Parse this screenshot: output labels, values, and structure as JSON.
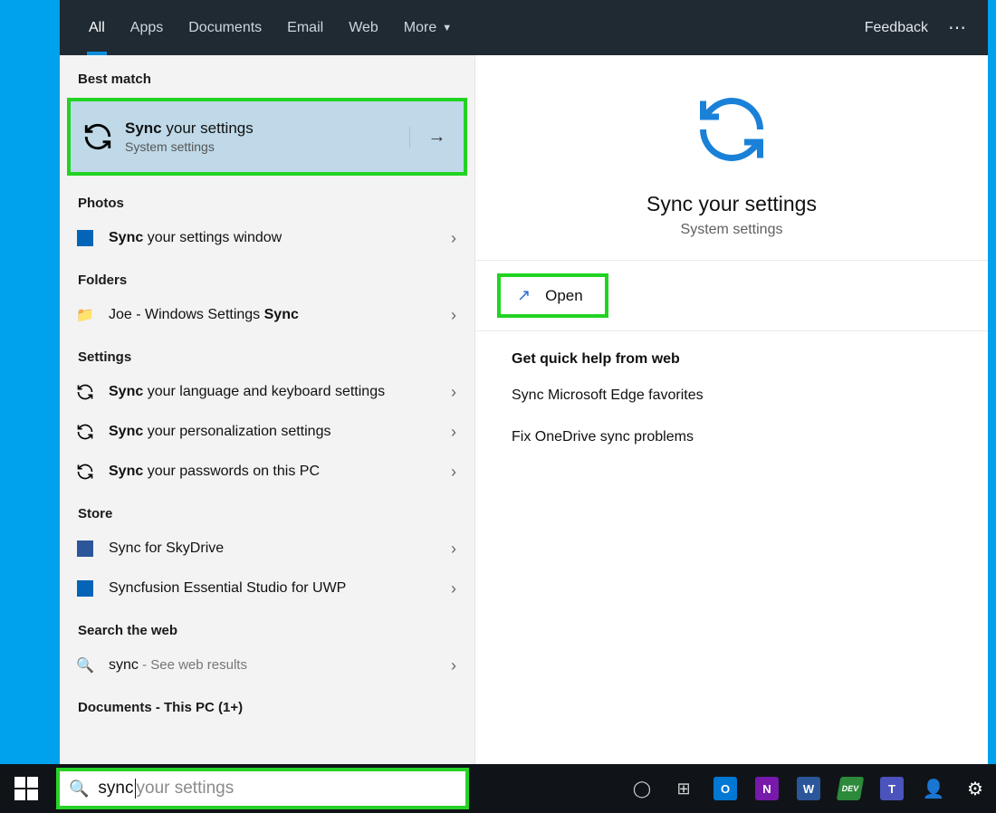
{
  "tabs": {
    "all": "All",
    "apps": "Apps",
    "documents": "Documents",
    "email": "Email",
    "web": "Web",
    "more": "More"
  },
  "top": {
    "feedback": "Feedback"
  },
  "sections": {
    "best_match": "Best match",
    "photos": "Photos",
    "folders": "Folders",
    "settings": "Settings",
    "store": "Store",
    "search_web": "Search the web",
    "documents_pc": "Documents - This PC (1+)"
  },
  "best": {
    "title_bold": "Sync",
    "title_rest": " your settings",
    "sub": "System settings"
  },
  "photos_item": {
    "bold": "Sync",
    "rest": " your settings window"
  },
  "folders_item": {
    "pre": "Joe - Windows Settings ",
    "bold": "Sync"
  },
  "settings_items": [
    {
      "bold": "Sync",
      "rest": " your language and keyboard settings"
    },
    {
      "bold": "Sync",
      "rest": " your personalization settings"
    },
    {
      "bold": "Sync",
      "rest": " your passwords on this PC"
    }
  ],
  "store_items": [
    {
      "label": "Sync for SkyDrive"
    },
    {
      "label": "Syncfusion Essential Studio for UWP"
    }
  ],
  "web_item": {
    "term": "sync",
    "suffix": " - See web results"
  },
  "right": {
    "title": "Sync your settings",
    "sub": "System settings",
    "open": "Open",
    "help_h": "Get quick help from web",
    "help_links": [
      "Sync Microsoft Edge favorites",
      "Fix OneDrive sync problems"
    ]
  },
  "search": {
    "entered": "sync",
    "ghost": " your settings"
  },
  "taskbar_apps": {
    "outlook": "O",
    "onenote": "N",
    "word": "W",
    "dev": "DEV",
    "teams": "T"
  }
}
